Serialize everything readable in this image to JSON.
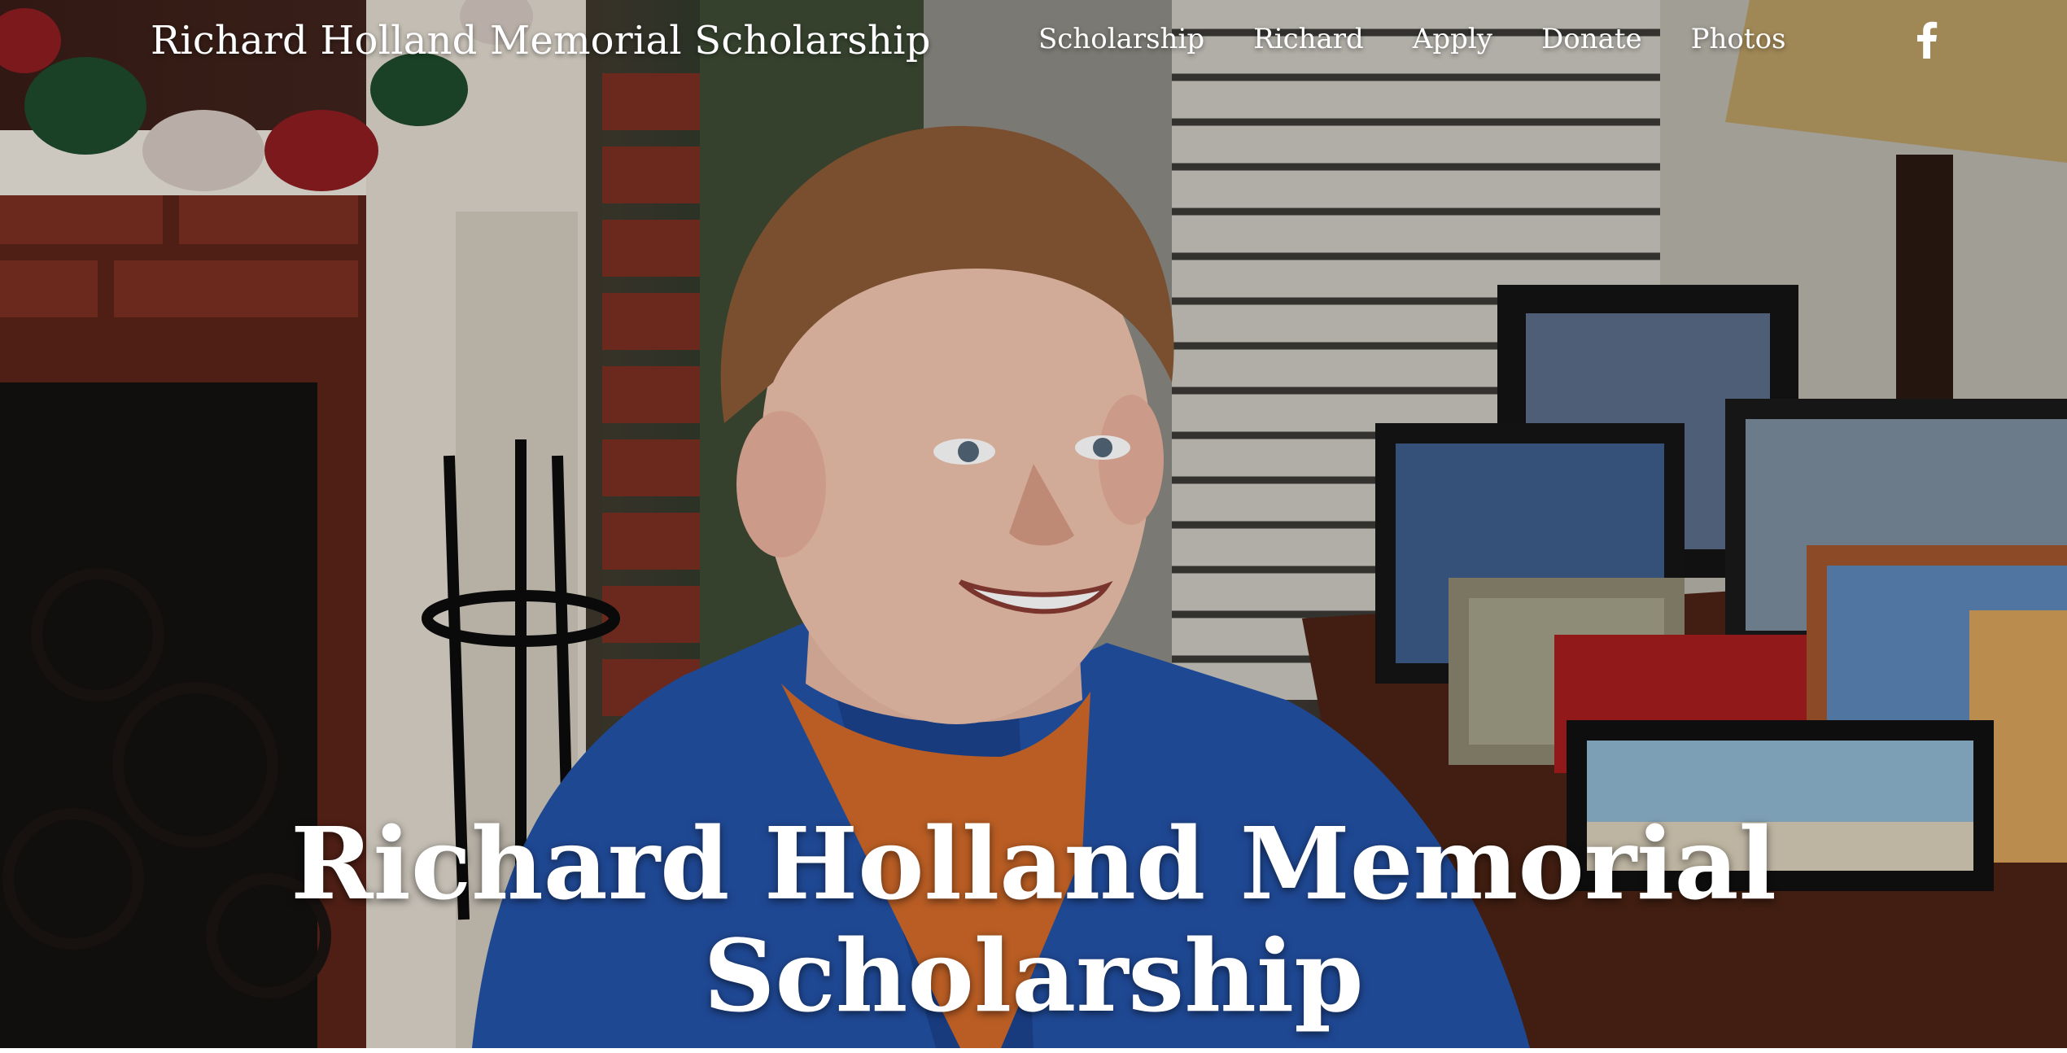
{
  "site": {
    "title": "Richard Holland Memorial Scholarship"
  },
  "nav": {
    "items": [
      {
        "label": "Scholarship"
      },
      {
        "label": "Richard"
      },
      {
        "label": "Apply"
      },
      {
        "label": "Donate"
      },
      {
        "label": "Photos"
      }
    ],
    "social_icon": "facebook-icon"
  },
  "hero": {
    "heading_line1": "Richard Holland Memorial",
    "heading_line2": "Scholarship",
    "image_alt": "smiling young man in blue jacket at home"
  },
  "colors": {
    "text": "#ffffff",
    "jacket_blue": "#2453a8",
    "shirt_orange": "#d36a2a",
    "brick": "#7a2f22"
  }
}
